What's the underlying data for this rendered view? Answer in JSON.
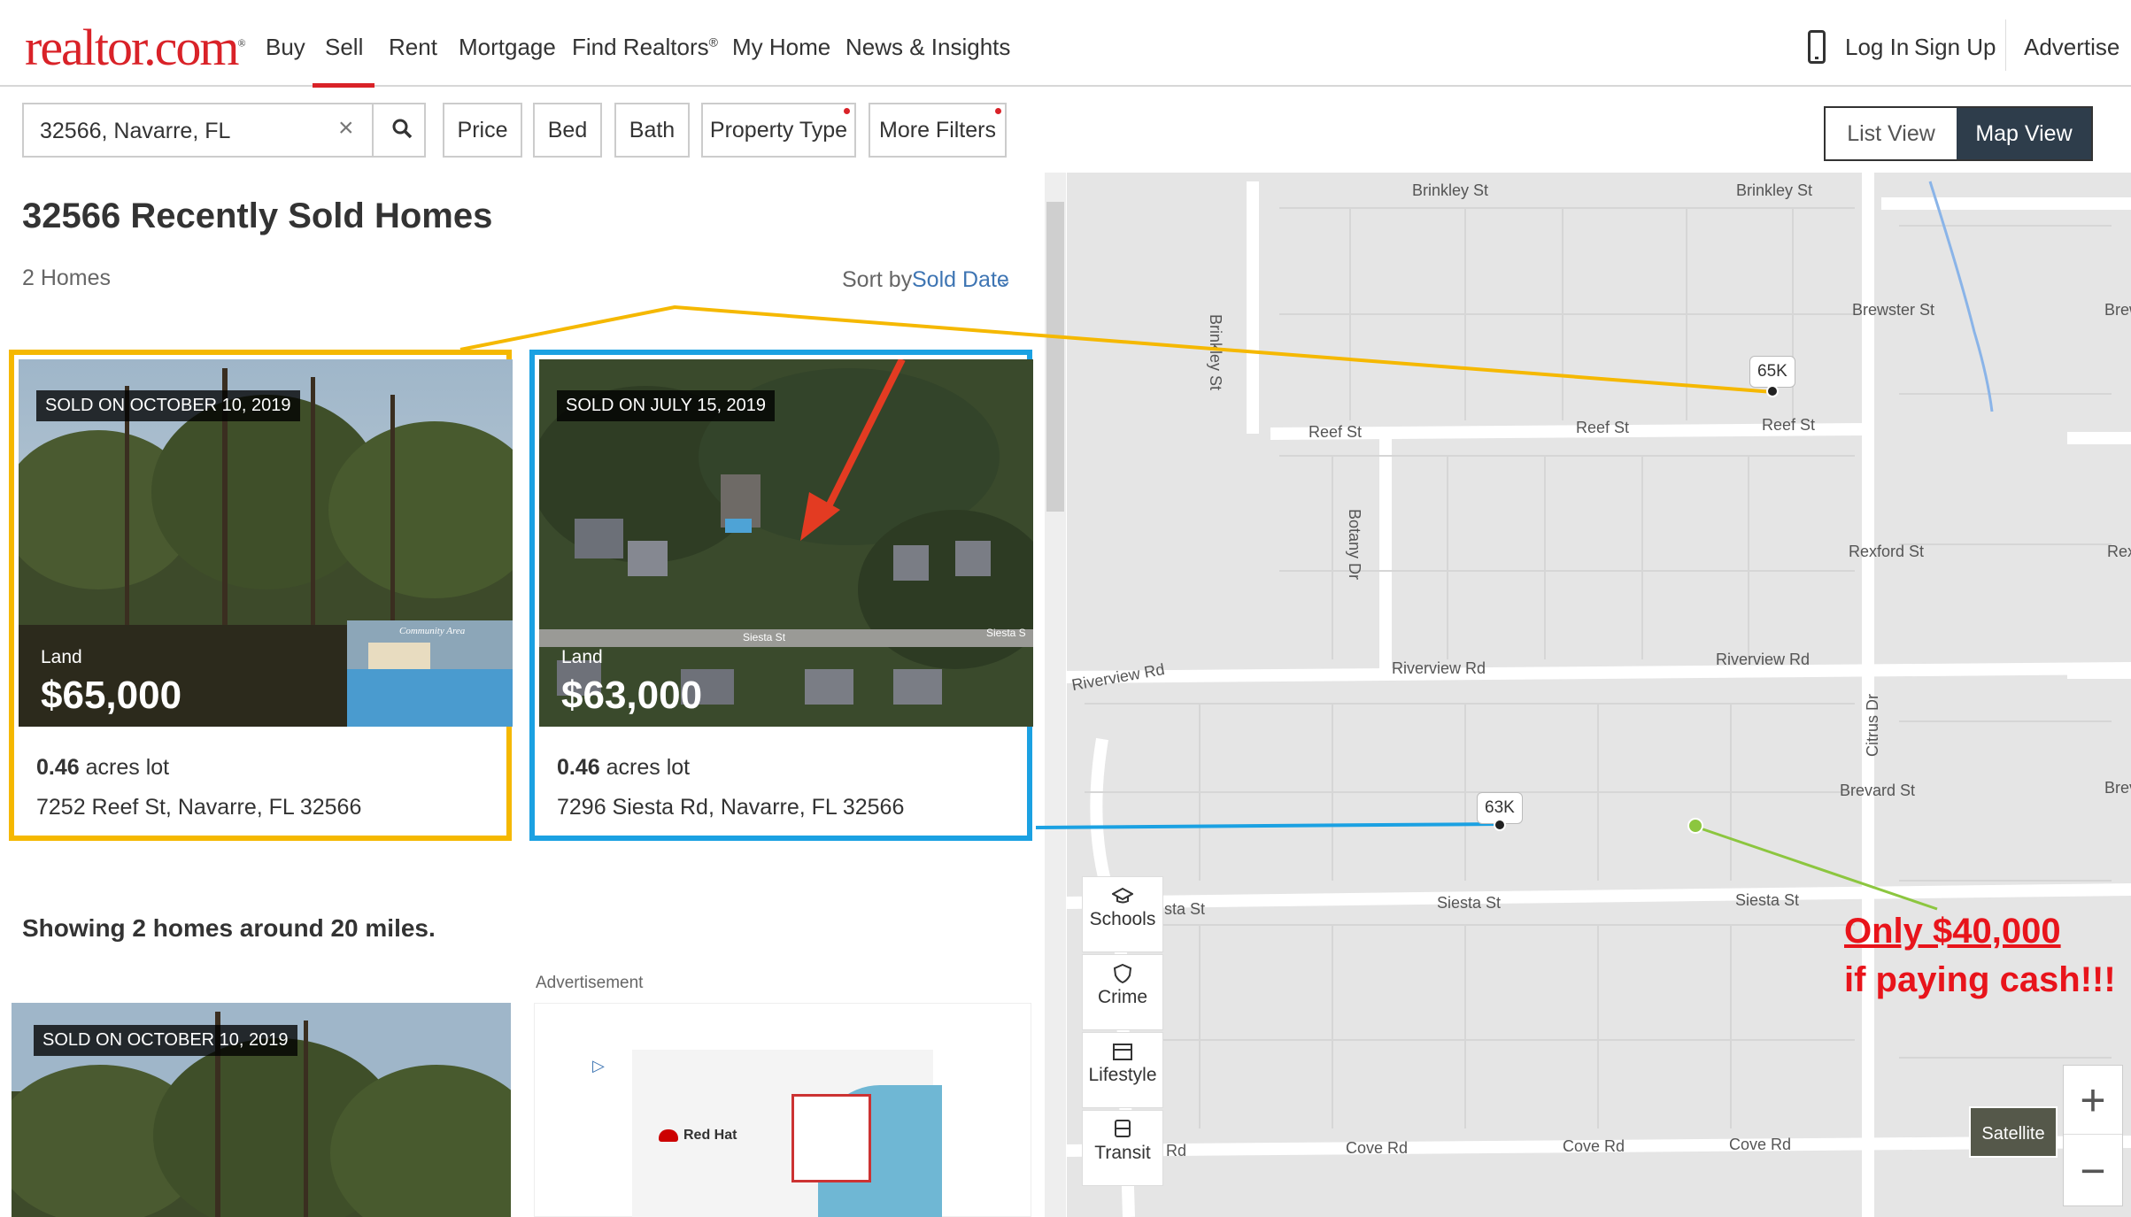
{
  "header": {
    "logo": "realtor.com",
    "nav": [
      "Buy",
      "Sell",
      "Rent",
      "Mortgage",
      "Find Realtors",
      "My Home",
      "News & Insights"
    ],
    "find_realtors_mark": "®",
    "login": "Log In",
    "signup": "Sign Up",
    "advertise": "Advertise"
  },
  "search": {
    "value": "32566, Navarre, FL",
    "clear": "×"
  },
  "filters": {
    "price": "Price",
    "bed": "Bed",
    "bath": "Bath",
    "property_type": "Property Type",
    "more_filters": "More Filters"
  },
  "view": {
    "list": "List View",
    "map": "Map View"
  },
  "results": {
    "title": "32566 Recently Sold Homes",
    "count": "2 Homes",
    "sort_label": "Sort by",
    "sort_value": "Sold Date",
    "showing": "Showing 2 homes around 20 miles.",
    "ad_label": "Advertisement",
    "ad_brand": "Red Hat"
  },
  "listings": [
    {
      "sold": "SOLD ON OCTOBER 10, 2019",
      "type": "Land",
      "price": "$65,000",
      "acres": "0.46",
      "acres_unit": "acres lot",
      "address": "7252 Reef St, Navarre, FL 32566",
      "photo_caption": "Community Area"
    },
    {
      "sold": "SOLD ON JULY 15, 2019",
      "type": "Land",
      "price": "$63,000",
      "acres": "0.46",
      "acres_unit": "acres lot",
      "address": "7296 Siesta Rd, Navarre, FL 32566",
      "photo_label_1": "Siesta St",
      "photo_label_2": "Siesta S"
    }
  ],
  "third_card": {
    "sold": "SOLD ON OCTOBER 10, 2019"
  },
  "map": {
    "pins": [
      {
        "label": "65K"
      },
      {
        "label": "63K"
      }
    ],
    "streets": {
      "brinkley_1": "Brinkley St",
      "brinkley_2": "Brinkley St",
      "brinkley_v": "Brinkley St",
      "brewster": "Brewster St",
      "brewster_edge": "Brew",
      "reef_1": "Reef St",
      "reef_2": "Reef St",
      "reef_3": "Reef St",
      "botany": "Botany Dr",
      "rexford": "Rexford St",
      "rexford_edge": "Rex",
      "riverview_1": "Riverview Rd",
      "riverview_2": "Riverview Rd",
      "riverview_3": "Riverview Rd",
      "citrus": "Citrus Dr",
      "brevard": "Brevard St",
      "brevard_edge": "Brev",
      "siesta_1": "sta St",
      "siesta_2": "Siesta St",
      "siesta_3": "Siesta St",
      "cove_0": "Rd",
      "cove_1": "Cove Rd",
      "cove_2": "Cove Rd",
      "cove_3": "Cove Rd"
    },
    "tools": [
      "Schools",
      "Crime",
      "Lifestyle",
      "Transit"
    ],
    "satellite": "Satellite",
    "zoom_in": "+",
    "zoom_out": "−",
    "annotation_line1": "Only $40,000",
    "annotation_line2": "if paying cash!!!"
  },
  "colors": {
    "brand_red": "#d92228",
    "link_blue": "#3e75b3",
    "highlight_yellow": "#f5b800",
    "highlight_blue": "#1ba1e2",
    "highlight_green": "#8cc63f",
    "annotation_red": "#e8141b"
  }
}
